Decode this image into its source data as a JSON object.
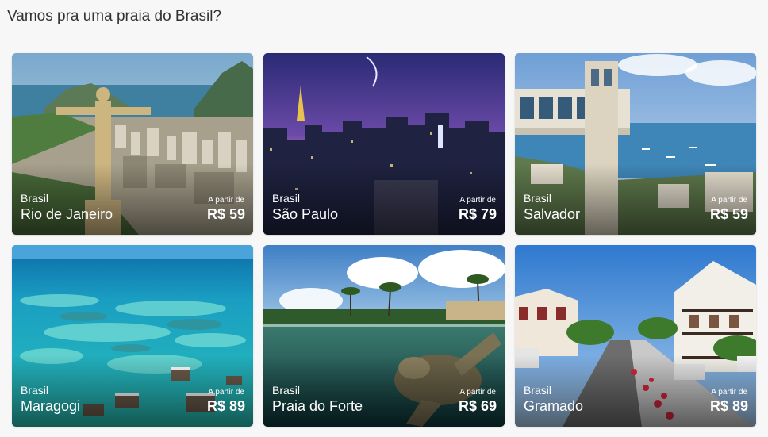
{
  "section": {
    "title": "Vamos pra uma praia do Brasil?"
  },
  "cards": [
    {
      "country": "Brasil",
      "city": "Rio de Janeiro",
      "from_label": "A partir de",
      "price": "R$ 59"
    },
    {
      "country": "Brasil",
      "city": "São Paulo",
      "from_label": "A partir de",
      "price": "R$ 79"
    },
    {
      "country": "Brasil",
      "city": "Salvador",
      "from_label": "A partir de",
      "price": "R$ 59"
    },
    {
      "country": "Brasil",
      "city": "Maragogi",
      "from_label": "A partir de",
      "price": "R$ 89"
    },
    {
      "country": "Brasil",
      "city": "Praia do Forte",
      "from_label": "A partir de",
      "price": "R$ 69"
    },
    {
      "country": "Brasil",
      "city": "Gramado",
      "from_label": "A partir de",
      "price": "R$ 89"
    }
  ],
  "colors": {
    "text_overlay": "#ffffff",
    "page_bg": "#f7f7f7",
    "title": "#333333"
  }
}
